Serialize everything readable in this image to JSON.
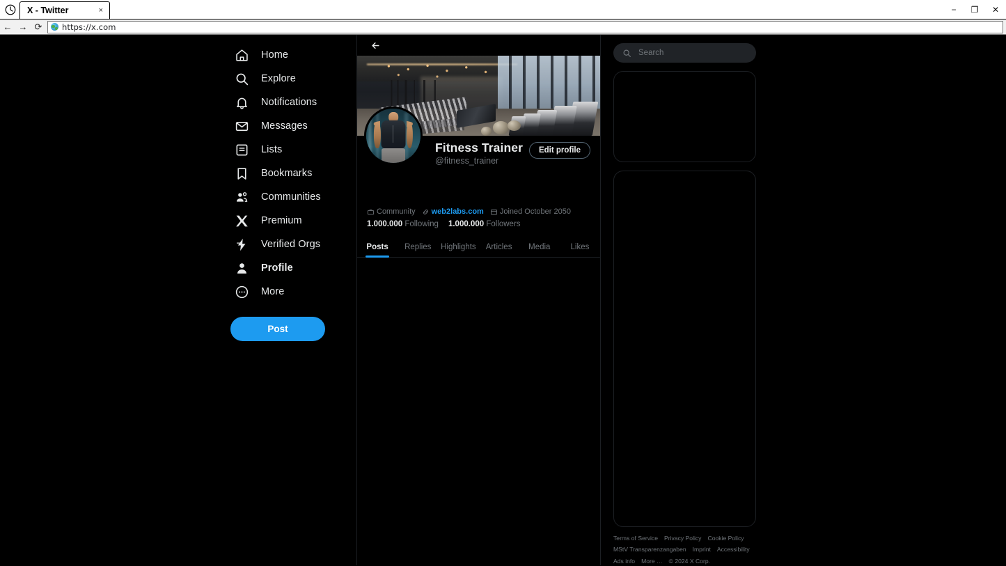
{
  "browser": {
    "app_icon": "clock-icon",
    "tab_title": "X - Twitter",
    "tab_close_label": "×",
    "minimize_label": "−",
    "maximize_label": "❐",
    "close_label": "✕",
    "back_label": "←",
    "forward_label": "→",
    "reload_label": "⟳",
    "url": "https://x.com",
    "favicon": "globe-icon"
  },
  "sidebar": {
    "items": [
      {
        "label": "Home",
        "icon": "home-icon",
        "active": false
      },
      {
        "label": "Explore",
        "icon": "search-icon",
        "active": false
      },
      {
        "label": "Notifications",
        "icon": "bell-icon",
        "active": false
      },
      {
        "label": "Messages",
        "icon": "envelope-icon",
        "active": false
      },
      {
        "label": "Lists",
        "icon": "list-icon",
        "active": false
      },
      {
        "label": "Bookmarks",
        "icon": "bookmark-icon",
        "active": false
      },
      {
        "label": "Communities",
        "icon": "people-icon",
        "active": false
      },
      {
        "label": "Premium",
        "icon": "x-logo-icon",
        "active": false
      },
      {
        "label": "Verified Orgs",
        "icon": "lightning-icon",
        "active": false
      },
      {
        "label": "Profile",
        "icon": "person-icon",
        "active": true
      },
      {
        "label": "More",
        "icon": "more-circle-icon",
        "active": false
      }
    ],
    "post_button": "Post"
  },
  "main": {
    "back_button": "back-arrow",
    "banner_alt": "gym interior with treadmills and dumbbell racks",
    "avatar_alt": "muscular man in dark tank top",
    "edit_profile_button": "Edit profile",
    "display_name": "Fitness Trainer",
    "handle": "@fitness_trainer",
    "meta": [
      {
        "icon": "briefcase-icon",
        "text": "Community",
        "link": false
      },
      {
        "icon": "link-icon",
        "text": "web2labs.com",
        "link": true
      },
      {
        "icon": "calendar-icon",
        "text": "Joined October 2050",
        "link": false
      }
    ],
    "stats": [
      {
        "value": "1.000.000",
        "label": "Following"
      },
      {
        "value": "1.000.000",
        "label": "Followers"
      }
    ],
    "tabs": [
      {
        "label": "Posts",
        "active": true
      },
      {
        "label": "Replies",
        "active": false
      },
      {
        "label": "Highlights",
        "active": false
      },
      {
        "label": "Articles",
        "active": false
      },
      {
        "label": "Media",
        "active": false
      },
      {
        "label": "Likes",
        "active": false
      }
    ]
  },
  "right": {
    "search_placeholder": "Search",
    "search_value": "",
    "search_icon": "search-icon",
    "cards": [
      {
        "content": ""
      },
      {
        "content": ""
      }
    ],
    "footer_links": [
      "Terms of Service",
      "Privacy Policy",
      "Cookie Policy",
      "MStV Transparenzangaben",
      "Imprint",
      "Accessibility",
      "Ads info",
      "More …"
    ],
    "copyright": "© 2024 X Corp."
  },
  "colors": {
    "accent": "#1d9bf0",
    "background": "#000000",
    "text_primary": "#e7e9ea",
    "text_secondary": "#71767b",
    "border": "#1c1f23",
    "search_bg": "#202327"
  }
}
